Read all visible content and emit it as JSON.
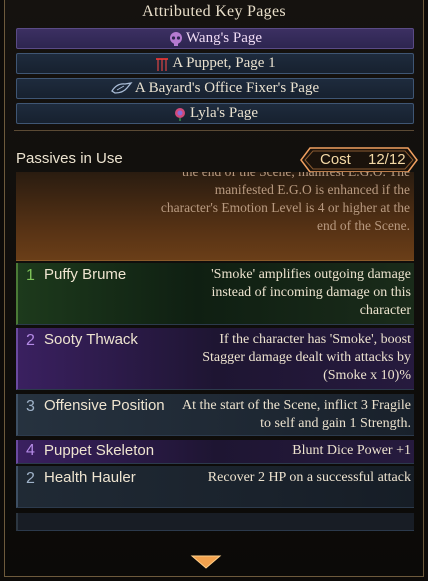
{
  "attributed": {
    "title": "Attributed Key Pages",
    "pages": [
      {
        "label": "Wang's Page",
        "icon": "skull-icon",
        "selected": true
      },
      {
        "label": "A Puppet, Page 1",
        "icon": "puppet-strings-icon",
        "selected": false
      },
      {
        "label": "A Bayard's Office Fixer's Page",
        "icon": "bird-wing-icon",
        "selected": false
      },
      {
        "label": "Lyla's Page",
        "icon": "rose-icon",
        "selected": false
      }
    ]
  },
  "passives": {
    "title": "Passives in Use",
    "cost_label": "Cost",
    "cost_value": "12/12",
    "partial_description": "the end of the Scene, manifest E.G.O. The manifested E.G.O is enhanced if the character's Emotion Level is 4 or higher at the end of the Scene.",
    "items": [
      {
        "cost": "1",
        "name": "Puffy Brume",
        "description": "'Smoke' amplifies outgoing damage instead of incoming damage on this character",
        "num_color": "#7fc45a"
      },
      {
        "cost": "2",
        "name": "Sooty Thwack",
        "description": "If the character has 'Smoke', boost Stagger damage dealt with attacks by (Smoke x 10)%",
        "num_color": "#b48ae6"
      },
      {
        "cost": "3",
        "name": "Offensive Position",
        "description": "At the start of the Scene, inflict 3 Fragile to self and gain 1 Strength.",
        "num_color": "#9fb2c8"
      },
      {
        "cost": "4",
        "name": "Puppet Skeleton",
        "description": "Blunt Dice Power +1",
        "num_color": "#b48ae6"
      },
      {
        "cost": "2",
        "name": "Health Hauler",
        "description": "Recover 2 HP on a successful attack",
        "num_color": "#9fb2c8"
      }
    ]
  },
  "colors": {
    "accent": "#f0a060",
    "selected_page": "#3c3062",
    "page_button": "#1e2b3d"
  }
}
